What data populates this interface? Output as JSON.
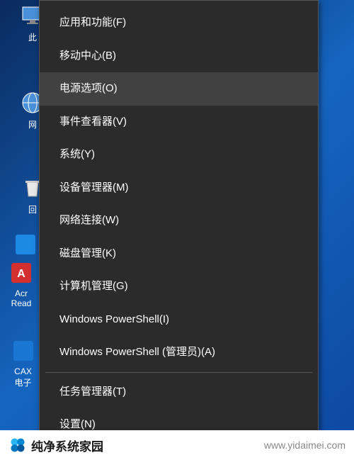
{
  "desktop": {
    "icons": [
      {
        "label": "此"
      },
      {
        "label": "网"
      },
      {
        "label": "回"
      },
      {
        "label": ""
      },
      {
        "label": "Acr\nRead"
      },
      {
        "label": "CAX\n电子"
      }
    ]
  },
  "contextMenu": {
    "items": [
      {
        "label": "应用和功能(F)",
        "highlighted": false
      },
      {
        "label": "移动中心(B)",
        "highlighted": false
      },
      {
        "label": "电源选项(O)",
        "highlighted": true
      },
      {
        "label": "事件查看器(V)",
        "highlighted": false
      },
      {
        "label": "系统(Y)",
        "highlighted": false
      },
      {
        "label": "设备管理器(M)",
        "highlighted": false
      },
      {
        "label": "网络连接(W)",
        "highlighted": false
      },
      {
        "label": "磁盘管理(K)",
        "highlighted": false
      },
      {
        "label": "计算机管理(G)",
        "highlighted": false
      },
      {
        "label": "Windows PowerShell(I)",
        "highlighted": false
      },
      {
        "label": "Windows PowerShell (管理员)(A)",
        "highlighted": false
      }
    ],
    "itemsAfterSeparator": [
      {
        "label": "任务管理器(T)",
        "highlighted": false
      },
      {
        "label": "设置(N)",
        "highlighted": false
      }
    ]
  },
  "watermark": {
    "title": "纯净系统家园",
    "url": "www.yidaimei.com"
  }
}
